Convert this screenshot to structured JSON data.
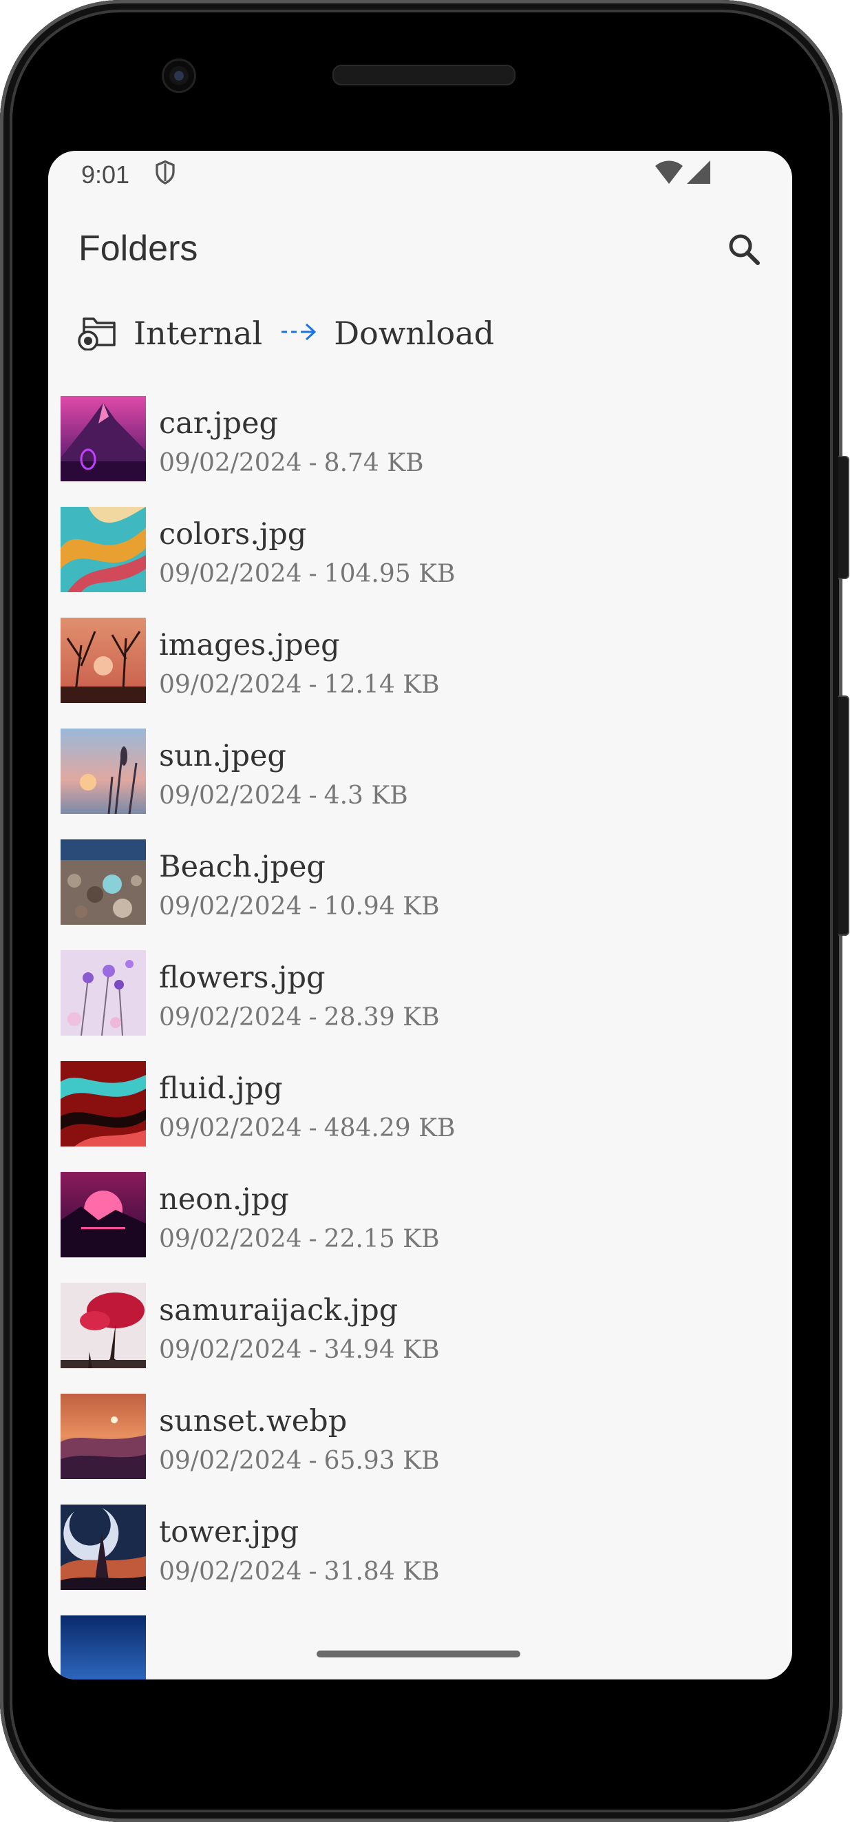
{
  "status_bar": {
    "time": "9:01",
    "shield_icon": "shield-icon",
    "wifi_icon": "wifi-icon",
    "signal_icon": "cell-signal-icon"
  },
  "header": {
    "title": "Folders",
    "search_icon": "search-icon"
  },
  "breadcrumb": {
    "root": "Internal",
    "current": "Download",
    "arrow_color": "#1a73e8"
  },
  "files": [
    {
      "name": "car.jpeg",
      "date": "09/02/2024",
      "size": "8.74 KB",
      "thumb": "thumb-mountain-neon"
    },
    {
      "name": "colors.jpg",
      "date": "09/02/2024",
      "size": "104.95 KB",
      "thumb": "thumb-color-swirl"
    },
    {
      "name": "images.jpeg",
      "date": "09/02/2024",
      "size": "12.14 KB",
      "thumb": "thumb-sunset-branches"
    },
    {
      "name": "sun.jpeg",
      "date": "09/02/2024",
      "size": "4.3 KB",
      "thumb": "thumb-sun-grass"
    },
    {
      "name": "Beach.jpeg",
      "date": "09/02/2024",
      "size": "10.94 KB",
      "thumb": "thumb-beach-pebbles"
    },
    {
      "name": "flowers.jpg",
      "date": "09/02/2024",
      "size": "28.39 KB",
      "thumb": "thumb-purple-flowers"
    },
    {
      "name": "fluid.jpg",
      "date": "09/02/2024",
      "size": "484.29 KB",
      "thumb": "thumb-red-fluid"
    },
    {
      "name": "neon.jpg",
      "date": "09/02/2024",
      "size": "22.15 KB",
      "thumb": "thumb-neon-sun"
    },
    {
      "name": "samuraijack.jpg",
      "date": "09/02/2024",
      "size": "34.94 KB",
      "thumb": "thumb-red-tree"
    },
    {
      "name": "sunset.webp",
      "date": "09/02/2024",
      "size": "65.93 KB",
      "thumb": "thumb-sunset-hills"
    },
    {
      "name": "tower.jpg",
      "date": "09/02/2024",
      "size": "31.84 KB",
      "thumb": "thumb-tower-moon"
    },
    {
      "name": "",
      "date": "",
      "size": "",
      "thumb": "thumb-blue-partial"
    }
  ]
}
